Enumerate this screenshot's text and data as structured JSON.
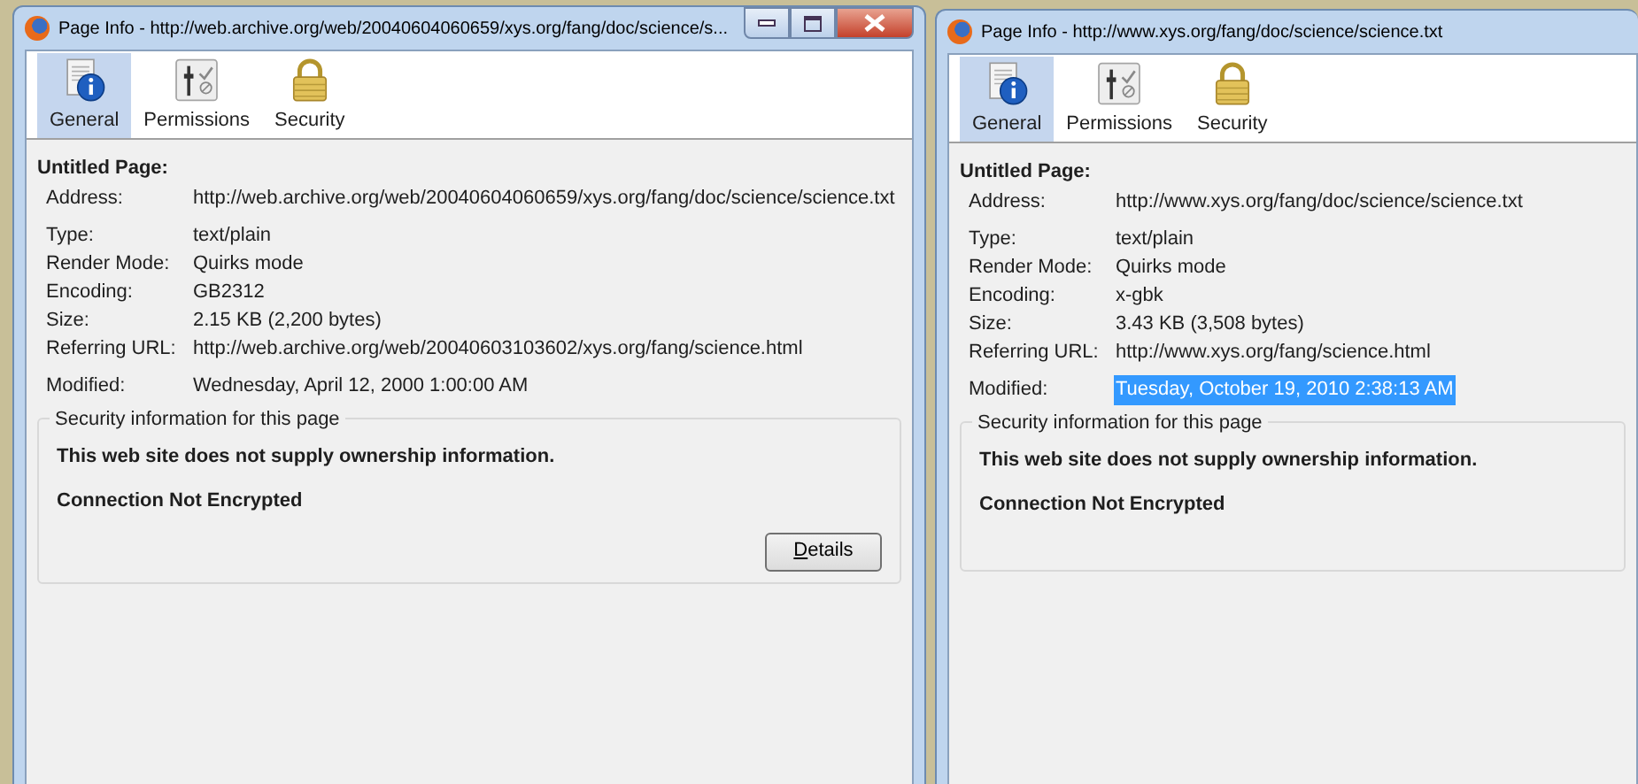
{
  "windows": [
    {
      "title": "Page Info - http://web.archive.org/web/20040604060659/xys.org/fang/doc/science/s...",
      "controls": true,
      "tabs": [
        {
          "label": "General",
          "selected": true
        },
        {
          "label": "Permissions",
          "selected": false
        },
        {
          "label": "Security",
          "selected": false
        }
      ],
      "page_title": "Untitled Page:",
      "field_groups": [
        [
          {
            "label": "Address:",
            "value": "http://web.archive.org/web/20040604060659/xys.org/fang/doc/science/science.txt",
            "highlighted": false
          }
        ],
        [
          {
            "label": "Type:",
            "value": "text/plain",
            "highlighted": false
          },
          {
            "label": "Render Mode:",
            "value": "Quirks mode",
            "highlighted": false
          },
          {
            "label": "Encoding:",
            "value": "GB2312",
            "highlighted": false
          },
          {
            "label": "Size:",
            "value": "2.15 KB (2,200 bytes)",
            "highlighted": false
          },
          {
            "label": "Referring URL:",
            "value": "http://web.archive.org/web/20040603103602/xys.org/fang/science.html",
            "highlighted": false
          }
        ],
        [
          {
            "label": "Modified:",
            "value": "Wednesday, April 12, 2000 1:00:00 AM",
            "highlighted": false
          }
        ]
      ],
      "security": {
        "legend": "Security information for this page",
        "lines": [
          "This web site does not supply ownership information.",
          "Connection Not Encrypted"
        ],
        "button": "Details"
      }
    },
    {
      "title": "Page Info - http://www.xys.org/fang/doc/science/science.txt",
      "controls": false,
      "tabs": [
        {
          "label": "General",
          "selected": true
        },
        {
          "label": "Permissions",
          "selected": false
        },
        {
          "label": "Security",
          "selected": false
        }
      ],
      "page_title": "Untitled Page:",
      "field_groups": [
        [
          {
            "label": "Address:",
            "value": "http://www.xys.org/fang/doc/science/science.txt",
            "highlighted": false
          }
        ],
        [
          {
            "label": "Type:",
            "value": "text/plain",
            "highlighted": false
          },
          {
            "label": "Render Mode:",
            "value": "Quirks mode",
            "highlighted": false
          },
          {
            "label": "Encoding:",
            "value": "x-gbk",
            "highlighted": false
          },
          {
            "label": "Size:",
            "value": "3.43 KB (3,508 bytes)",
            "highlighted": false
          },
          {
            "label": "Referring URL:",
            "value": "http://www.xys.org/fang/science.html",
            "highlighted": false
          }
        ],
        [
          {
            "label": "Modified:",
            "value": "Tuesday, October 19, 2010 2:38:13 AM",
            "highlighted": true
          }
        ]
      ],
      "security": {
        "legend": "Security information for this page",
        "lines": [
          "This web site does not supply ownership information.",
          "Connection Not Encrypted"
        ]
      }
    }
  ]
}
